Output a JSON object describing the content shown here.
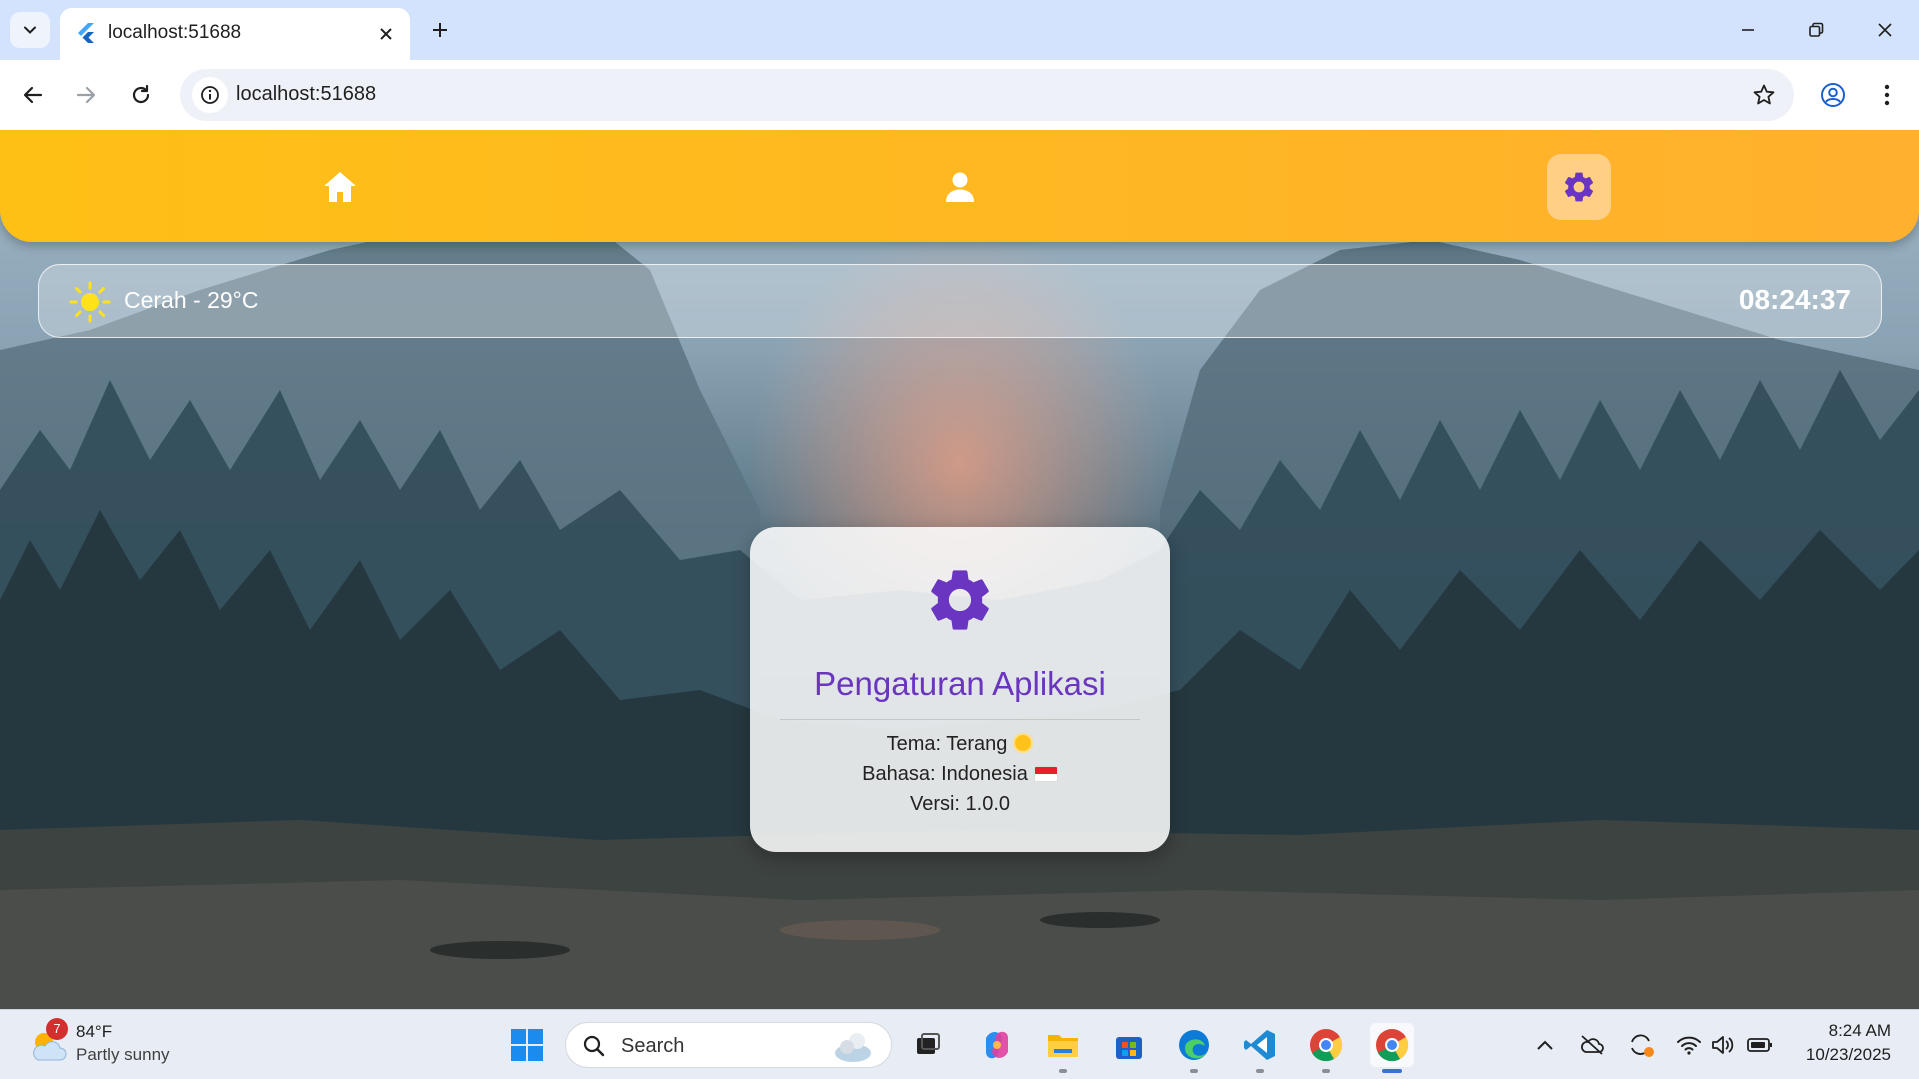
{
  "browser": {
    "tab_title": "localhost:51688",
    "url": "localhost:51688"
  },
  "app": {
    "nav": {
      "items": [
        {
          "name": "home",
          "icon": "home-icon"
        },
        {
          "name": "profile",
          "icon": "person-icon"
        },
        {
          "name": "settings",
          "icon": "gear-icon",
          "active": true
        }
      ]
    },
    "weather_bar": {
      "condition": "Cerah - 29°C",
      "time": "08:24:37"
    },
    "settings_card": {
      "title": "Pengaturan Aplikasi",
      "theme": "Tema: Terang",
      "language": "Bahasa: Indonesia",
      "version": "Versi: 1.0.0"
    },
    "colors": {
      "nav_gradient_start": "#ffc015",
      "nav_gradient_end": "#ffb02e",
      "accent_purple": "#6a35c0"
    }
  },
  "taskbar": {
    "weather": {
      "badge": "7",
      "temp": "84°F",
      "desc": "Partly sunny"
    },
    "search_label": "Search",
    "clock_time": "8:24 AM",
    "clock_date": "10/23/2025"
  }
}
